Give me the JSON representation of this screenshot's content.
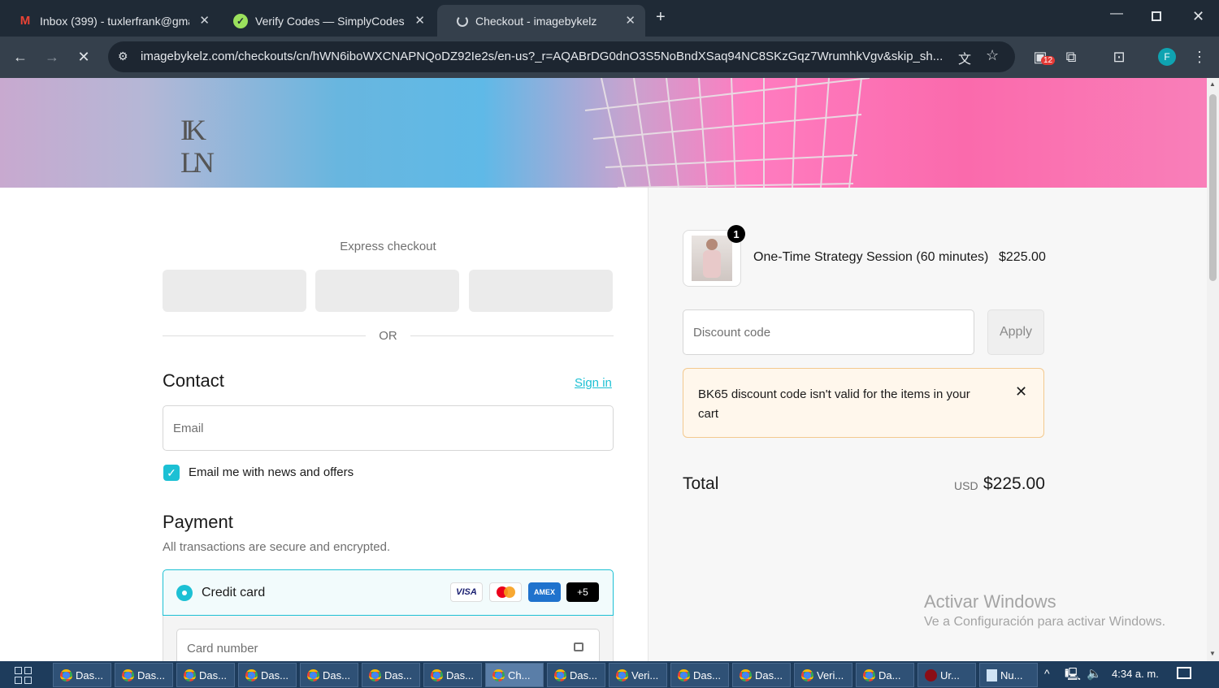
{
  "browser": {
    "tabs": [
      {
        "label": "Inbox (399) - tuxlerfrank@gmail.com",
        "icon": "gmail-icon"
      },
      {
        "label": "Verify Codes — SimplyCodes",
        "icon": "simplycodes-icon"
      },
      {
        "label": "Checkout - imagebykelz",
        "icon": "loading-icon"
      }
    ],
    "url": "imagebykelz.com/checkouts/cn/hWN6iboWXCNAPNQoDZ92Ie2s/en-us?_r=AQABrDG0dnO3S5NoBndXSaq94NC8SKzGqz7WrumhkVgv&skip_sh...",
    "extension_badge": "12",
    "profile_initial": "F"
  },
  "checkout": {
    "express_label": "Express checkout",
    "or_label": "OR",
    "contact_heading": "Contact",
    "sign_in": "Sign in",
    "email_placeholder": "Email",
    "newsletter_label": "Email me with news and offers",
    "payment_heading": "Payment",
    "payment_subtitle": "All transactions are secure and encrypted.",
    "credit_card_label": "Credit card",
    "card_brands": [
      "VISA",
      "AMEX",
      "+5"
    ],
    "card_number_placeholder": "Card number"
  },
  "summary": {
    "item_qty": "1",
    "item_name": "One-Time Strategy Session (60 minutes)",
    "item_price": "$225.00",
    "discount_placeholder": "Discount code",
    "apply_label": "Apply",
    "error_message": "BK65 discount code isn't valid for the items in your cart",
    "total_label": "Total",
    "currency": "USD",
    "total_amount": "$225.00"
  },
  "watermark": {
    "title": "Activar Windows",
    "subtitle": "Ve a Configuración para activar Windows."
  },
  "taskbar": {
    "buttons": [
      "Das...",
      "Das...",
      "Das...",
      "Das...",
      "Das...",
      "Das...",
      "Das...",
      "Ch...",
      "Das...",
      "Veri...",
      "Das...",
      "Das...",
      "Veri...",
      "Da...",
      "Ur...",
      "Nu..."
    ],
    "clock": "4:34 a. m."
  },
  "colors": {
    "accent": "#1cc0d4",
    "error_bg": "#fff7ec",
    "error_border": "#f3c98f"
  }
}
